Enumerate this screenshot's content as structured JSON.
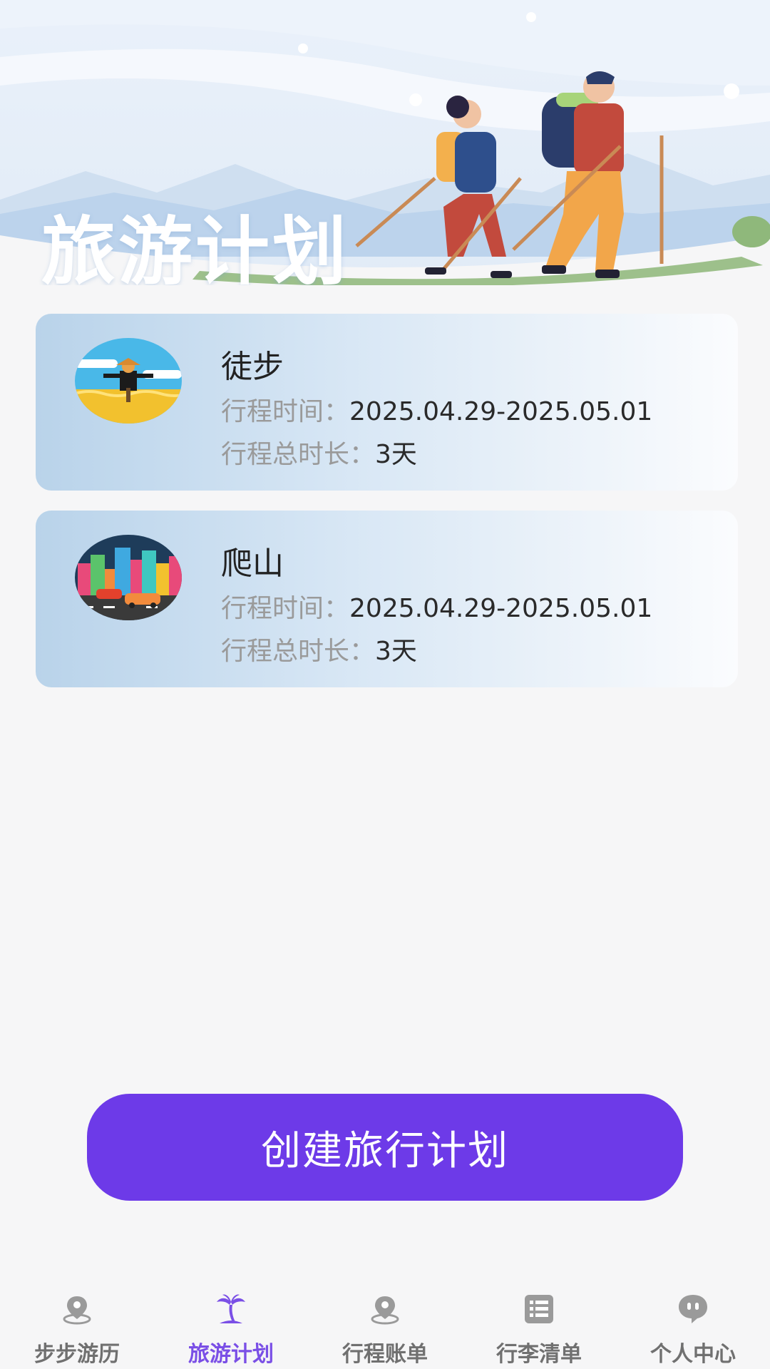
{
  "header": {
    "title": "旅游计划"
  },
  "plans": [
    {
      "name": "徒步",
      "time_label": "行程时间：",
      "time_value": "2025.04.29-2025.05.01",
      "duration_label": "行程总时长：",
      "duration_value": "3天",
      "icon": "scarecrow-field-thumbnail"
    },
    {
      "name": "爬山",
      "time_label": "行程时间：",
      "time_value": "2025.04.29-2025.05.01",
      "duration_label": "行程总时长：",
      "duration_value": "3天",
      "icon": "city-street-thumbnail"
    }
  ],
  "create_button": {
    "label": "创建旅行计划"
  },
  "tabbar": {
    "active_index": 1,
    "active_color": "#7a4fe6",
    "inactive_color": "#707070",
    "items": [
      {
        "label": "步步游历",
        "icon": "location-pin-icon"
      },
      {
        "label": "旅游计划",
        "icon": "palm-tree-icon"
      },
      {
        "label": "行程账单",
        "icon": "location-pin-icon"
      },
      {
        "label": "行李清单",
        "icon": "list-icon"
      },
      {
        "label": "个人中心",
        "icon": "chat-face-icon"
      }
    ]
  },
  "colors": {
    "accent": "#6d3ae8",
    "card_gradient_start": "#b9d3ea",
    "background": "#f6f6f7"
  }
}
